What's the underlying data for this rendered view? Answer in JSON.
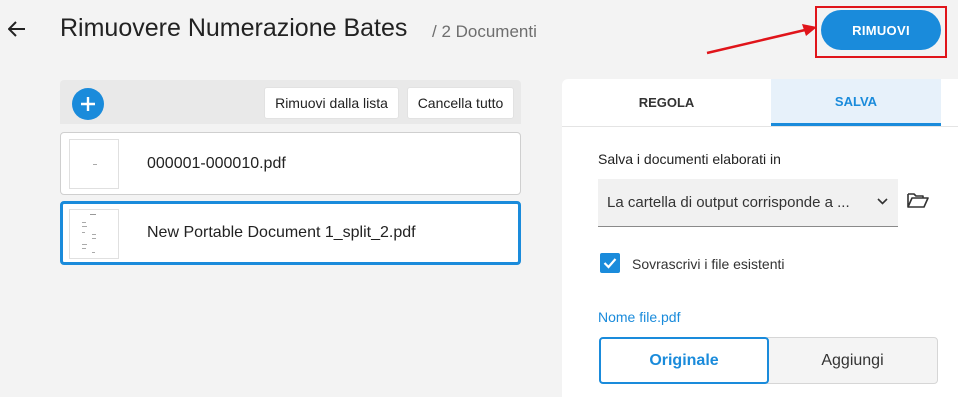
{
  "header": {
    "title": "Rimuovere Numerazione Bates",
    "doc_count": "/ 2 Documenti",
    "primary_button": "RIMUOVI",
    "annotation_color": "#e0141a",
    "accent": "#1a8bdb"
  },
  "toolbar": {
    "add_icon": "plus-icon",
    "remove_from_list": "Rimuovi dalla lista",
    "clear_all": "Cancella tutto"
  },
  "files": [
    {
      "name": "000001-000010.pdf",
      "selected": false
    },
    {
      "name": "New Portable Document 1_split_2.pdf",
      "selected": true
    }
  ],
  "panel": {
    "tabs": [
      {
        "label": "REGOLA",
        "active": false
      },
      {
        "label": "SALVA",
        "active": true
      }
    ],
    "save_label": "Salva i documenti elaborati in",
    "output_select": "La cartella di output corrisponde a ...",
    "overwrite_label": "Sovrascrivi i file esistenti",
    "overwrite_checked": true,
    "filename_label": "Nome file.pdf",
    "name_options": [
      {
        "label": "Originale",
        "selected": true
      },
      {
        "label": "Aggiungi",
        "selected": false
      }
    ]
  }
}
